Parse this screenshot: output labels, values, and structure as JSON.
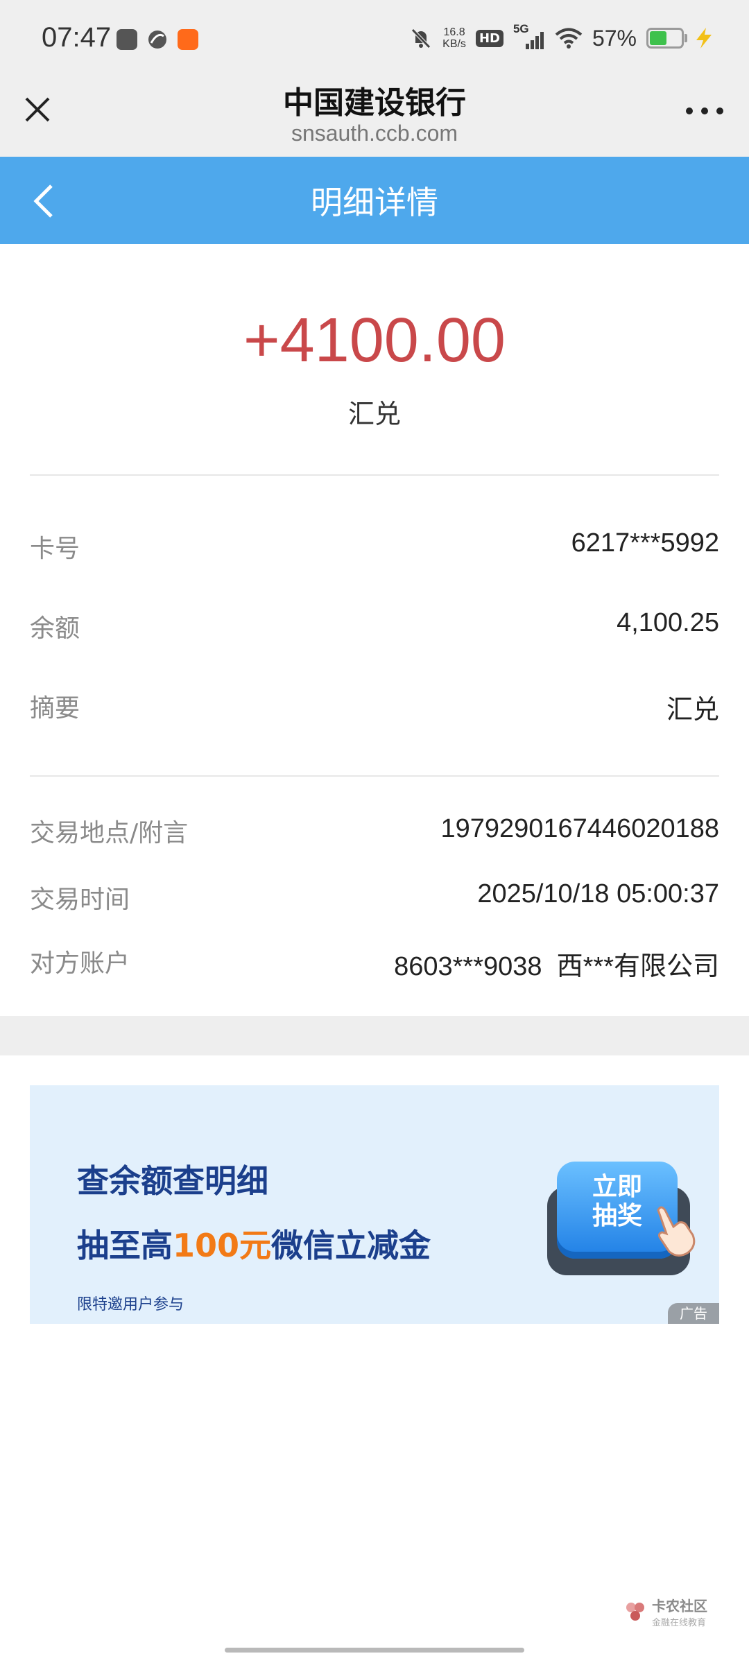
{
  "status_bar": {
    "time": "07:47",
    "net_speed_value": "16.8",
    "net_speed_unit": "KB/s",
    "hd": "HD",
    "signal": "5G",
    "battery": "57%",
    "battery_level": 0.57
  },
  "browser": {
    "title": "中国建设银行",
    "url": "snsauth.ccb.com"
  },
  "header": {
    "title": "明细详情"
  },
  "transaction": {
    "amount": "+4100.00",
    "type": "汇兑",
    "amount_color": "#c9484a"
  },
  "details_group1": [
    {
      "label": "卡号",
      "value": "6217***5992"
    },
    {
      "label": "余额",
      "value": "4,100.25"
    },
    {
      "label": "摘要",
      "value": "汇兑"
    }
  ],
  "details_group2": [
    {
      "label": "交易地点/附言",
      "value": "197929016744602018‍8"
    },
    {
      "label": "交易时间",
      "value": "2025/10/18 05:00:37"
    },
    {
      "label": "对方账户",
      "value": "8603***9038  西***有限公司"
    }
  ],
  "ad": {
    "line1": "查余额查明细",
    "line2_pre": "抽至高",
    "line2_highlight": "100元",
    "line2_post": "微信立减金",
    "line3": "限特邀用户参与",
    "button_line1": "立即",
    "button_line2": "抽奖",
    "tag": "广告"
  },
  "watermark": {
    "name": "卡农社区",
    "slogan": "金融在线教育"
  },
  "colors": {
    "header": "#4ea8ec",
    "amount": "#c9484a",
    "ad_text": "#1b3f8c",
    "ad_highlight": "#f27a16"
  },
  "icons": [
    "close-icon",
    "more-icon",
    "back-icon",
    "mute-icon",
    "wifi-icon",
    "signal-icon",
    "battery-icon",
    "charging-icon",
    "hand-icon"
  ]
}
